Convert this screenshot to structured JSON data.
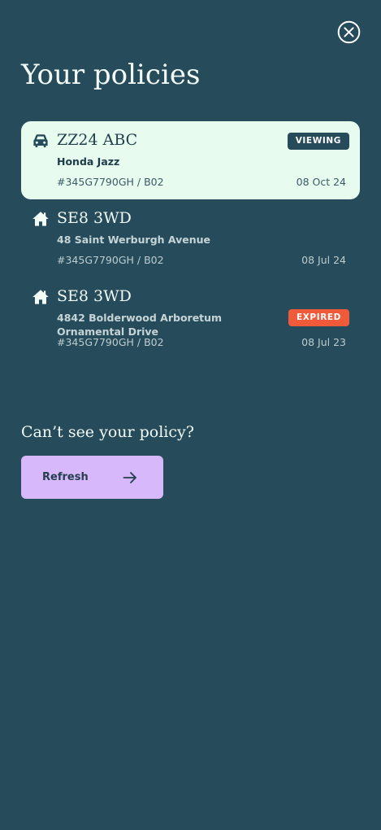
{
  "header": {
    "close_icon": "close-circle-icon",
    "title": "Your policies"
  },
  "policies": [
    {
      "type_icon": "car-icon",
      "title": "ZZ24 ABC",
      "subtitle": "Honda Jazz",
      "reference": "#345G7790GH / B02",
      "date": "08 Oct 24",
      "badge": "VIEWING",
      "active": true
    },
    {
      "type_icon": "home-icon",
      "title": "SE8 3WD",
      "subtitle": "48 Saint Werburgh Avenue",
      "reference": "#345G7790GH / B02",
      "date": "08 Jul 24"
    },
    {
      "type_icon": "home-icon",
      "title": "SE8 3WD",
      "subtitle": "4842 Bolderwood Arboretum Ornamental Drive",
      "reference": "#345G7790GH / B02",
      "date": "08 Jul 23",
      "badge": "EXPIRED"
    }
  ],
  "footer": {
    "prompt": "Can’t see your policy?",
    "refresh_label": "Refresh",
    "refresh_icon": "arrow-right-icon"
  },
  "colors": {
    "background": "#264b5a",
    "active_card": "#e8fbef",
    "viewing_badge": "#264b5a",
    "expired_badge": "#ef5b3a",
    "refresh_button": "#d6b8fb"
  }
}
